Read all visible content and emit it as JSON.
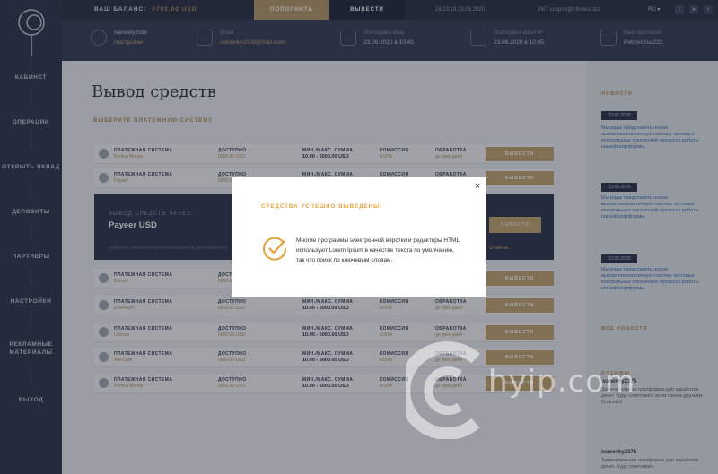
{
  "topbar": {
    "balance_label": "ВАШ БАЛАНС:",
    "balance_value": "0700.00 USD",
    "deposit_button": "ПОПОЛНИТЬ",
    "withdraw_button": "ВЫВЕСТИ",
    "clock": "16:23:18   23.06.2020",
    "support": "24/7   support@cfinnest.biz",
    "lang": "RU"
  },
  "infobar": {
    "user_login": "ivanovky2039",
    "user_sub": "Настройки",
    "email_label": "Email",
    "email_value": "ivanovky2039@mail.com",
    "last_login_label": "Последний вход",
    "last_login_value": "23.06.2020 в 10:45",
    "last_ip_label": "Последний визит IP",
    "last_ip_value": "23.06.2020 в 10:45",
    "referrer_label": "Ваш пригласил",
    "referrer_value": "Petrovchsa222"
  },
  "sidebar": {
    "items": [
      "КАБИНЕТ",
      "ОПЕРАЦИИ",
      "ОТКРЫТЬ ВКЛАД",
      "ДЕПОЗИТЫ",
      "ПАРТНЕРЫ",
      "НАСТРОЙКИ",
      "РЕКЛАМНЫЕ МАТЕРИАЛЫ",
      "ВЫХОД"
    ]
  },
  "main": {
    "title": "Вывод средств",
    "subtitle": "ВЫБЕРИТЕ ПЛАТЕЖНУЮ СИСТЕМУ",
    "col_system": "ПЛАТЕЖНАЯ СИСТЕМА",
    "col_available": "ДОСТУПНО",
    "col_limits": "МИН./МАКС. СУММА",
    "col_fee": "КОМИССИЯ",
    "col_processing": "ОБРАБОТКА",
    "row_button": "ВЫВЕСТИ",
    "rows": [
      {
        "name": "Perfect Money",
        "available": "0000.00 USD",
        "limits": "10.00 - 5000.00 USD",
        "fee": "0.00%",
        "processing": "до трех дней"
      },
      {
        "name": "Payeer",
        "available": "0000.00 USD",
        "limits": "10.00 - 5000.00 USD",
        "fee": "0.00%",
        "processing": "до трех дней"
      },
      {
        "name": "Bitcoin",
        "available": "0000.00 USD",
        "limits": "10.00 - 5000.00 USD",
        "fee": "0.00%",
        "processing": "до трех дней"
      },
      {
        "name": "Ethereum",
        "available": "0000.00 USD",
        "limits": "10.00 - 5000.00 USD",
        "fee": "0.00%",
        "processing": "до трех дней"
      },
      {
        "name": "Litecoin",
        "available": "0000.00 USD",
        "limits": "10.00 - 5000.00 USD",
        "fee": "0.00%",
        "processing": "до трех дней"
      },
      {
        "name": "AdvCash",
        "available": "0000.00 USD",
        "limits": "10.00 - 5000.00 USD",
        "fee": "0.00%",
        "processing": "до трех дней"
      },
      {
        "name": "Perfect Money",
        "available": "0000.00 USD",
        "limits": "10.00 - 5000.00 USD",
        "fee": "0.00%",
        "processing": "до трех дней"
      }
    ],
    "expanded": {
      "label": "ВЫВОД СРЕДСТВ ЧЕРЕЗ:",
      "value": "Payeer USD",
      "button": "ВЫВЕСТИ",
      "note": "Комиссия платежной системы взимается дополнительно",
      "link": "Отмена"
    }
  },
  "right": {
    "news_heading": "НОВОСТИ",
    "news": [
      {
        "date": "23.06.2020",
        "text": "Мы рады представить новую высокотехнологичную систему тестовых контрольных технологий процесса работы нашей платформы"
      },
      {
        "date": "23.06.2020",
        "text": "Мы рады представить новую высокотехнологичную систему тестовых контрольных технологий процесса работы нашей платформы"
      },
      {
        "date": "23.06.2020",
        "text": "Мы рады представить новую высокотехнологичную систему тестовых контрольных технологий процесса работы нашей платформы"
      }
    ],
    "reviews_heading": "ВСЕ НОВОСТИ",
    "reviews_label": "ОТЗЫВЫ",
    "reviews": [
      {
        "name": "ivanovky2375",
        "text": "Замечательная платформа для заработка денег. Буду советовать всем своим друзьям. Спасибо!"
      },
      {
        "name": "ivanovky2375",
        "text": "Замечательная платформа для заработка денег. Буду советовать"
      }
    ]
  },
  "modal": {
    "heading": "СРЕДСТВА УСПЕШНО ВЫВЕДЕНЫ!",
    "close": "×",
    "body": "Многие программы электронной вёрстки и редакторы HTML используют Lorem Ipsum в качестве текста по умолчанию, так что поиск по ключевым словам."
  },
  "watermark": "hyip.com",
  "colors": {
    "accent": "#c5a673",
    "sidebar": "#2e374e",
    "success": "#e8a23b"
  }
}
